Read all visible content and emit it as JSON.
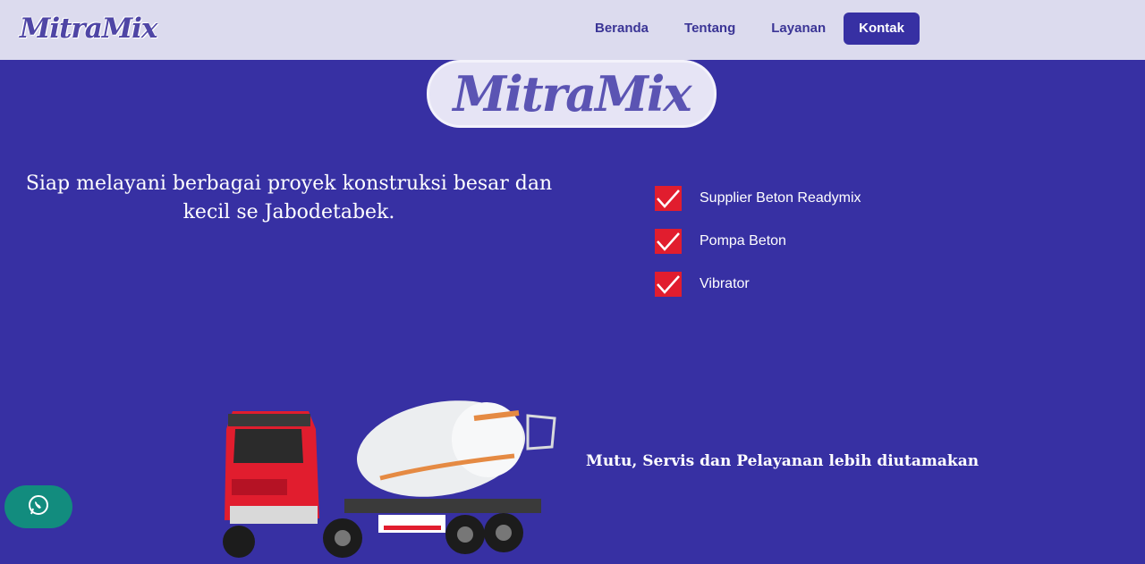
{
  "nav": {
    "brand": "MitraMix",
    "links": [
      "Beranda",
      "Tentang",
      "Layanan",
      "Kontak"
    ]
  },
  "hero": {
    "logo": "MitraMix",
    "tagline": "Siap melayani berbagai proyek konstruksi besar dan kecil se Jabodetabek."
  },
  "services": [
    "Supplier Beton Readymix",
    "Pompa Beton",
    "Vibrator"
  ],
  "motto": "Mutu, Servis dan Pelayanan lebih diutamakan",
  "icons": {
    "whatsapp": "whatsapp-icon",
    "check": "check-icon"
  },
  "colors": {
    "background": "#3730a3",
    "navbar": "#dcdbee",
    "check": "#e11d2e",
    "whatsapp": "#128c7e"
  }
}
